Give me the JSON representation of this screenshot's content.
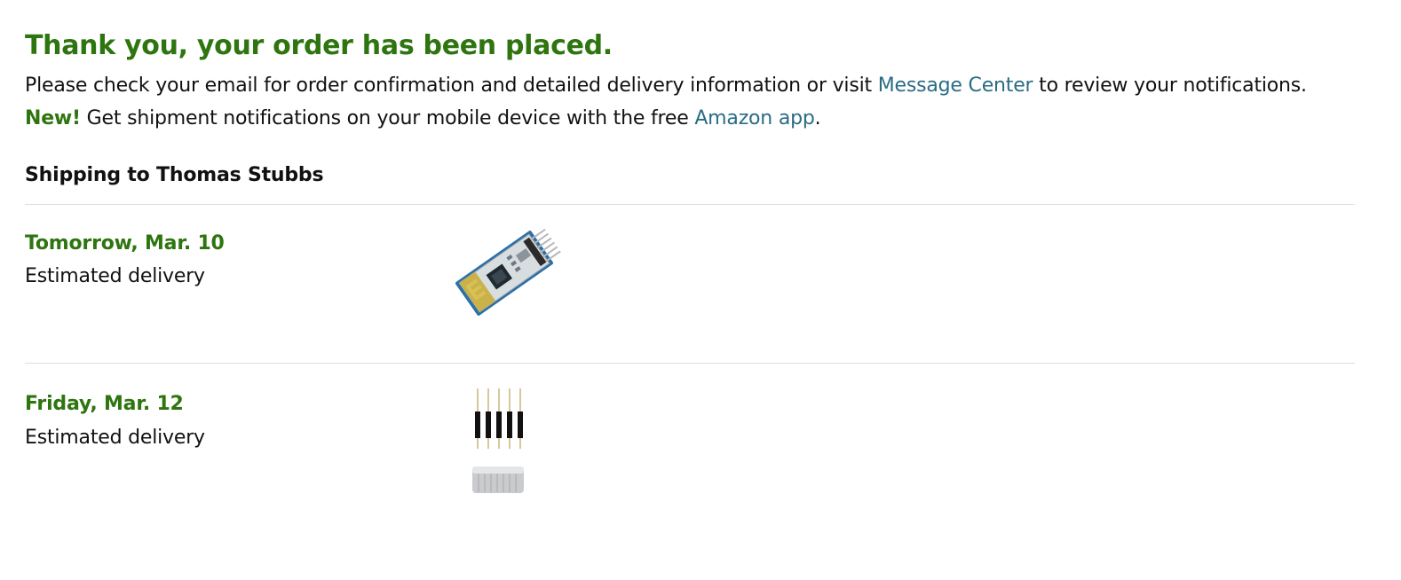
{
  "confirmation": {
    "headline": "Thank you, your order has been placed.",
    "line1_before": "Please check your email for order confirmation and detailed delivery information or visit ",
    "message_center_link": "Message Center",
    "line1_after": " to review your notifications.",
    "new_badge": "New!",
    "line2_before": " Get shipment notifications on your mobile device with the free ",
    "amazon_app_link": "Amazon app",
    "line2_after": "."
  },
  "shipping": {
    "label": "Shipping to Thomas Stubbs"
  },
  "shipments": [
    {
      "date": "Tomorrow, Mar. 10",
      "status": "Estimated delivery",
      "item_icon": "bluetooth-module-image"
    },
    {
      "date": "Friday, Mar. 12",
      "status": "Estimated delivery",
      "item_icon": "pins-and-magnets-image"
    }
  ],
  "colors": {
    "success_green": "#2e7510",
    "link_teal": "#2a6c84",
    "divider": "#dddddd"
  }
}
